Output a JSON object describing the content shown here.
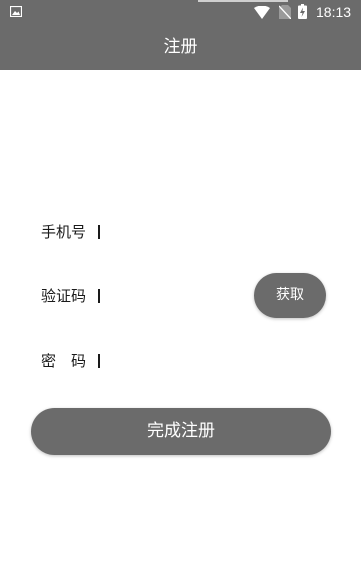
{
  "status_bar": {
    "time": "18:13",
    "icons": [
      "image-icon",
      "wifi-icon",
      "no-sim-icon",
      "battery-charging-icon"
    ]
  },
  "app_bar": {
    "title": "注册"
  },
  "form": {
    "phone": {
      "label": "手机号",
      "value": "",
      "placeholder": ""
    },
    "code": {
      "label": "验证码",
      "value": "",
      "placeholder": ""
    },
    "password": {
      "label": "密　码",
      "value": "",
      "placeholder": ""
    },
    "fetch_code_label": "获取",
    "submit_label": "完成注册"
  },
  "colors": {
    "primary": "#6b6b6b",
    "on_primary": "#ffffff",
    "text": "#1a1a1a",
    "background": "#ffffff"
  }
}
